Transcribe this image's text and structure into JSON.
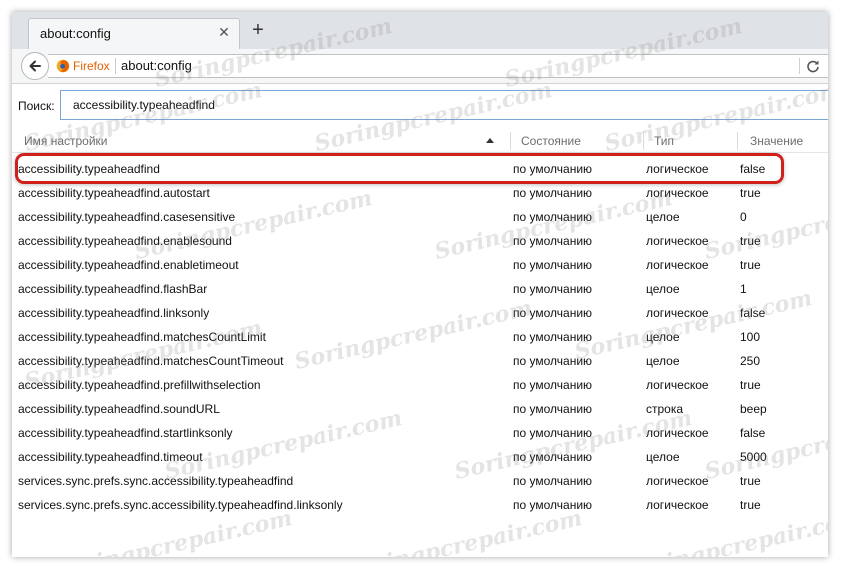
{
  "tab": {
    "title": "about:config"
  },
  "nav": {
    "identity_label": "Firefox",
    "url": "about:config"
  },
  "search": {
    "label": "Поиск:",
    "value": "accessibility.typeaheadfind"
  },
  "columns": {
    "name": "Имя настройки",
    "state": "Состояние",
    "type": "Тип",
    "value": "Значение"
  },
  "rows": [
    {
      "name": "accessibility.typeaheadfind",
      "state": "по умолчанию",
      "type": "логическое",
      "value": "false"
    },
    {
      "name": "accessibility.typeaheadfind.autostart",
      "state": "по умолчанию",
      "type": "логическое",
      "value": "true"
    },
    {
      "name": "accessibility.typeaheadfind.casesensitive",
      "state": "по умолчанию",
      "type": "целое",
      "value": "0"
    },
    {
      "name": "accessibility.typeaheadfind.enablesound",
      "state": "по умолчанию",
      "type": "логическое",
      "value": "true"
    },
    {
      "name": "accessibility.typeaheadfind.enabletimeout",
      "state": "по умолчанию",
      "type": "логическое",
      "value": "true"
    },
    {
      "name": "accessibility.typeaheadfind.flashBar",
      "state": "по умолчанию",
      "type": "целое",
      "value": "1"
    },
    {
      "name": "accessibility.typeaheadfind.linksonly",
      "state": "по умолчанию",
      "type": "логическое",
      "value": "false"
    },
    {
      "name": "accessibility.typeaheadfind.matchesCountLimit",
      "state": "по умолчанию",
      "type": "целое",
      "value": "100"
    },
    {
      "name": "accessibility.typeaheadfind.matchesCountTimeout",
      "state": "по умолчанию",
      "type": "целое",
      "value": "250"
    },
    {
      "name": "accessibility.typeaheadfind.prefillwithselection",
      "state": "по умолчанию",
      "type": "логическое",
      "value": "true"
    },
    {
      "name": "accessibility.typeaheadfind.soundURL",
      "state": "по умолчанию",
      "type": "строка",
      "value": "beep"
    },
    {
      "name": "accessibility.typeaheadfind.startlinksonly",
      "state": "по умолчанию",
      "type": "логическое",
      "value": "false"
    },
    {
      "name": "accessibility.typeaheadfind.timeout",
      "state": "по умолчанию",
      "type": "целое",
      "value": "5000"
    },
    {
      "name": "services.sync.prefs.sync.accessibility.typeaheadfind",
      "state": "по умолчанию",
      "type": "логическое",
      "value": "true"
    },
    {
      "name": "services.sync.prefs.sync.accessibility.typeaheadfind.linksonly",
      "state": "по умолчанию",
      "type": "логическое",
      "value": "true"
    }
  ],
  "watermark": {
    "text": "Soringpcrepair.com"
  },
  "colors": {
    "highlight": "#d0201c",
    "identity": "#e66000",
    "search_border": "#7aa7d8"
  },
  "icons": [
    "back-arrow-icon",
    "firefox-logo-icon",
    "close-icon",
    "plus-icon",
    "reload-icon",
    "sort-ascending-icon"
  ]
}
